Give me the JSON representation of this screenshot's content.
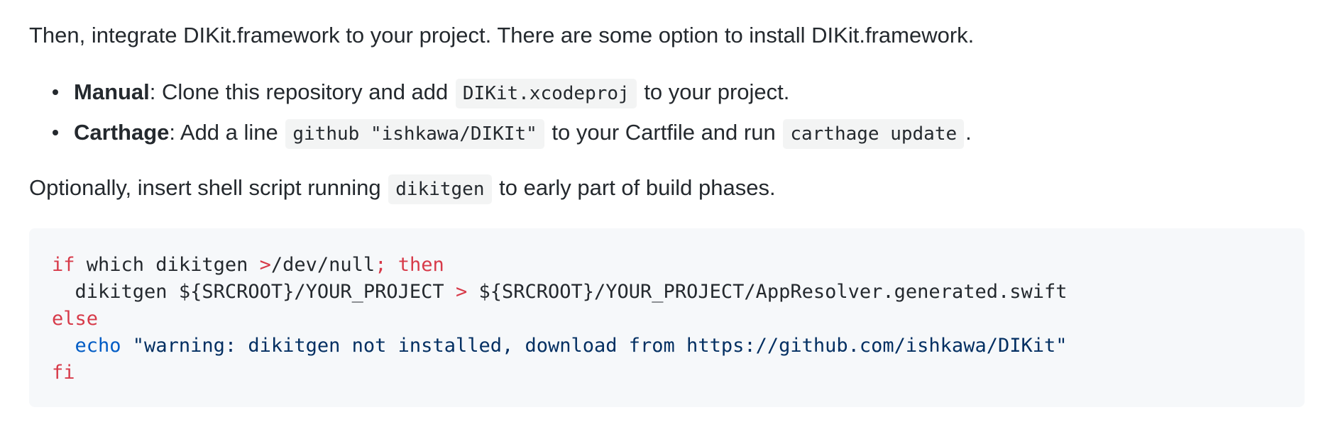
{
  "intro": "Then, integrate DIKit.framework to your project. There are some option to install DIKit.framework.",
  "options": [
    {
      "name": "Manual",
      "sep": ": ",
      "text1": "Clone this repository and add ",
      "code1": "DIKit.xcodeproj",
      "text2": " to your project."
    },
    {
      "name": "Carthage",
      "sep": ": ",
      "text1": "Add a line ",
      "code1": "github \"ishkawa/DIKIt\"",
      "text2": " to your Cartfile and run ",
      "code2": "carthage update",
      "text3": "."
    }
  ],
  "optional": {
    "text1": "Optionally, insert shell script running ",
    "code": "dikitgen",
    "text2": " to early part of build phases."
  },
  "code_block": {
    "line1": {
      "kw_if": "if",
      "cmd": " which dikitgen ",
      "redir": ">",
      "path": "/dev/null",
      "semi": ";",
      "kw_then": " then"
    },
    "line2": {
      "indent": "  ",
      "cmd": "dikitgen ${SRCROOT}/YOUR_PROJECT ",
      "redir": ">",
      "rest": " ${SRCROOT}/YOUR_PROJECT/AppResolver.generated.swift"
    },
    "line3": {
      "kw_else": "else"
    },
    "line4": {
      "indent": "  ",
      "builtin": "echo",
      "string": " \"warning: dikitgen not installed, download from https://github.com/ishkawa/DIKit\""
    },
    "line5": {
      "kw_fi": "fi"
    }
  }
}
